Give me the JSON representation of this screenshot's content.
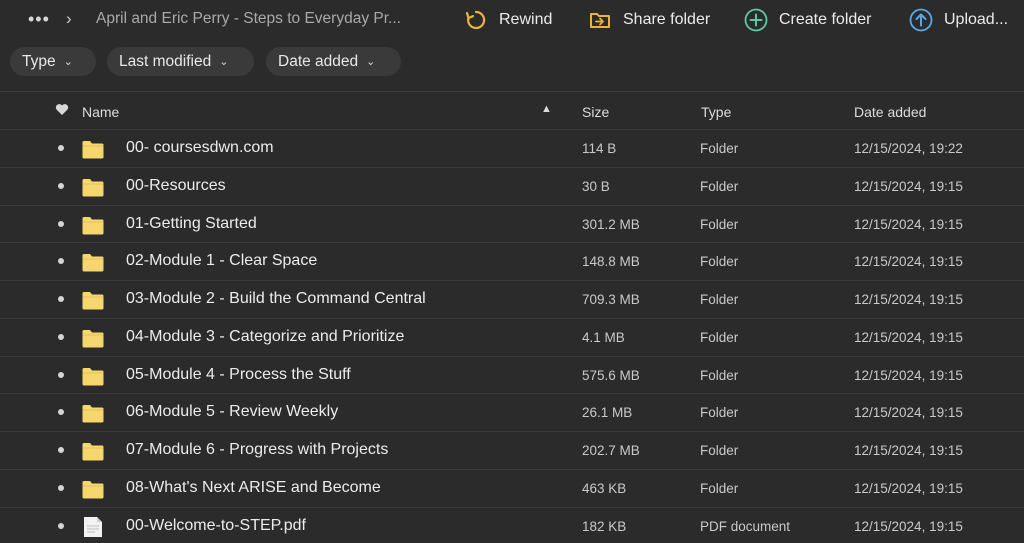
{
  "toolbar": {
    "more_icon": "more-icon",
    "breadcrumb_sep": "›",
    "breadcrumb": "April and Eric Perry - Steps to Everyday Pr...",
    "rewind_label": "Rewind",
    "share_label": "Share folder",
    "create_label": "Create folder",
    "upload_label": "Upload..."
  },
  "filters": {
    "type_label": "Type",
    "modified_label": "Last modified",
    "added_label": "Date added"
  },
  "columns": {
    "name": "Name",
    "size": "Size",
    "type": "Type",
    "date": "Date added"
  },
  "colors": {
    "accent_rewind": "#e8b43a",
    "accent_share": "#e8b43a",
    "accent_create": "#5cc9a7",
    "accent_upload": "#5aa8e6",
    "folder": "#f5d76e"
  },
  "files": [
    {
      "name": "00- coursesdwn.com",
      "size": "114 B",
      "type": "Folder",
      "date": "12/15/2024, 19:22",
      "icon": "folder-icon"
    },
    {
      "name": "00-Resources",
      "size": "30 B",
      "type": "Folder",
      "date": "12/15/2024, 19:15",
      "icon": "folder-icon"
    },
    {
      "name": "01-Getting Started",
      "size": "301.2 MB",
      "type": "Folder",
      "date": "12/15/2024, 19:15",
      "icon": "folder-icon"
    },
    {
      "name": "02-Module 1 - Clear Space",
      "size": "148.8 MB",
      "type": "Folder",
      "date": "12/15/2024, 19:15",
      "icon": "folder-icon"
    },
    {
      "name": "03-Module 2 - Build the Command Central",
      "size": "709.3 MB",
      "type": "Folder",
      "date": "12/15/2024, 19:15",
      "icon": "folder-icon"
    },
    {
      "name": "04-Module 3 - Categorize and Prioritize",
      "size": "4.1 MB",
      "type": "Folder",
      "date": "12/15/2024, 19:15",
      "icon": "folder-icon"
    },
    {
      "name": "05-Module 4 - Process the Stuff",
      "size": "575.6 MB",
      "type": "Folder",
      "date": "12/15/2024, 19:15",
      "icon": "folder-icon"
    },
    {
      "name": "06-Module 5 - Review Weekly",
      "size": "26.1 MB",
      "type": "Folder",
      "date": "12/15/2024, 19:15",
      "icon": "folder-icon"
    },
    {
      "name": "07-Module 6 - Progress with Projects",
      "size": "202.7 MB",
      "type": "Folder",
      "date": "12/15/2024, 19:15",
      "icon": "folder-icon"
    },
    {
      "name": "08-What's Next ARISE and Become",
      "size": "463 KB",
      "type": "Folder",
      "date": "12/15/2024, 19:15",
      "icon": "folder-icon"
    },
    {
      "name": "00-Welcome-to-STEP.pdf",
      "size": "182 KB",
      "type": "PDF document",
      "date": "12/15/2024, 19:15",
      "icon": "pdf-file-icon"
    }
  ]
}
